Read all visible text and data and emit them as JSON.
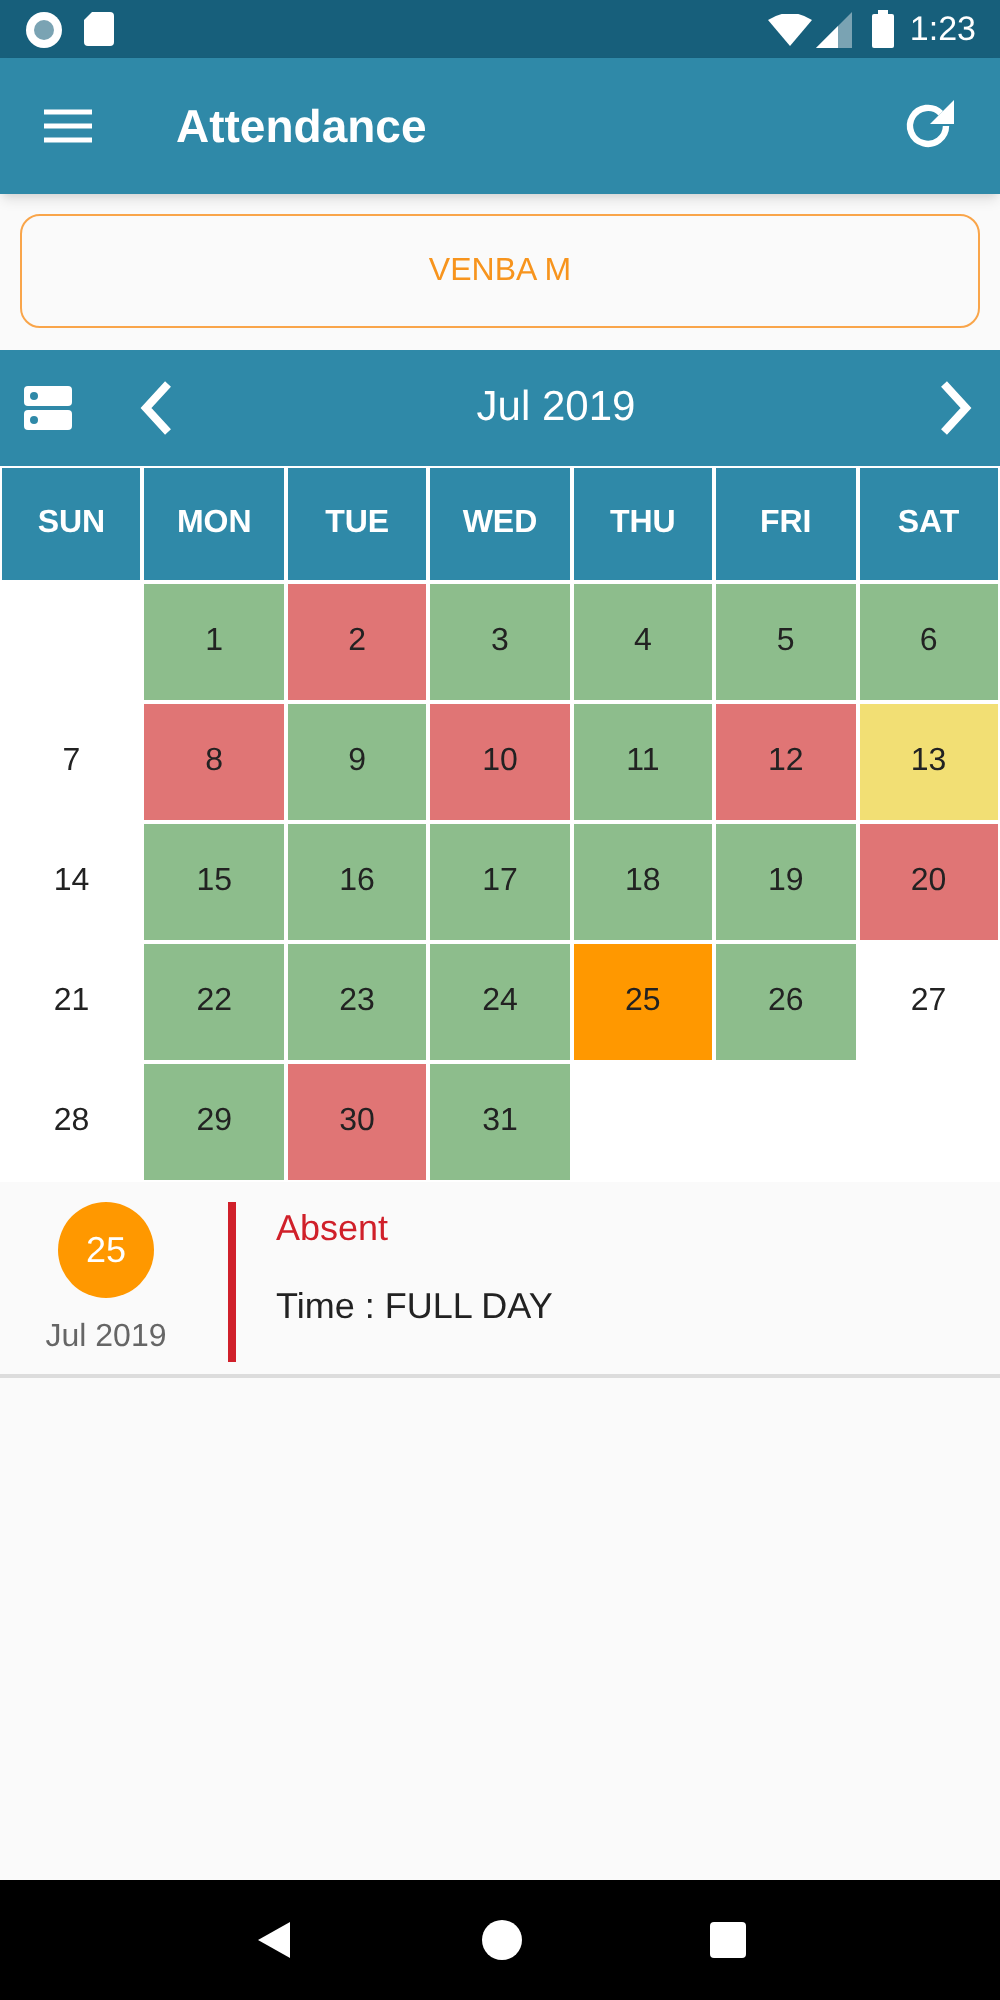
{
  "status_bar": {
    "time": "1:23"
  },
  "app_bar": {
    "title": "Attendance"
  },
  "employee": {
    "name": "VENBA M"
  },
  "calendar": {
    "month": "Jul 2019",
    "weekdays": [
      "SUN",
      "MON",
      "TUE",
      "WED",
      "THU",
      "FRI",
      "SAT"
    ],
    "weeks": [
      [
        {
          "kind": "blank"
        },
        {
          "kind": "day",
          "day": "1",
          "color": "#8dbd8c",
          "selected": false
        },
        {
          "kind": "day",
          "day": "2",
          "color": "#e07575",
          "selected": false
        },
        {
          "kind": "day",
          "day": "3",
          "color": "#8dbd8c",
          "selected": false
        },
        {
          "kind": "day",
          "day": "4",
          "color": "#8dbd8c",
          "selected": false
        },
        {
          "kind": "day",
          "day": "5",
          "color": "#8dbd8c",
          "selected": false
        },
        {
          "kind": "day",
          "day": "6",
          "color": "#8dbd8c",
          "selected": false
        }
      ],
      [
        {
          "kind": "day",
          "day": "7",
          "selected": false
        },
        {
          "kind": "day",
          "day": "8",
          "color": "#e07575",
          "selected": false
        },
        {
          "kind": "day",
          "day": "9",
          "color": "#8dbd8c",
          "selected": false
        },
        {
          "kind": "day",
          "day": "10",
          "color": "#e07575",
          "selected": false
        },
        {
          "kind": "day",
          "day": "11",
          "color": "#8dbd8c",
          "selected": false
        },
        {
          "kind": "day",
          "day": "12",
          "color": "#e07575",
          "selected": false
        },
        {
          "kind": "day",
          "day": "13",
          "color": "#f2df74",
          "selected": false
        }
      ],
      [
        {
          "kind": "day",
          "day": "14",
          "selected": false
        },
        {
          "kind": "day",
          "day": "15",
          "color": "#8dbd8c",
          "selected": false
        },
        {
          "kind": "day",
          "day": "16",
          "color": "#8dbd8c",
          "selected": false
        },
        {
          "kind": "day",
          "day": "17",
          "color": "#8dbd8c",
          "selected": false
        },
        {
          "kind": "day",
          "day": "18",
          "color": "#8dbd8c",
          "selected": false
        },
        {
          "kind": "day",
          "day": "19",
          "color": "#8dbd8c",
          "selected": false
        },
        {
          "kind": "day",
          "day": "20",
          "color": "#e07575",
          "selected": false
        }
      ],
      [
        {
          "kind": "day",
          "day": "21",
          "selected": false
        },
        {
          "kind": "day",
          "day": "22",
          "color": "#8dbd8c",
          "selected": false
        },
        {
          "kind": "day",
          "day": "23",
          "color": "#8dbd8c",
          "selected": false
        },
        {
          "kind": "day",
          "day": "24",
          "color": "#8dbd8c",
          "selected": false
        },
        {
          "kind": "day",
          "day": "25",
          "selected": true
        },
        {
          "kind": "day",
          "day": "26",
          "color": "#8dbd8c",
          "selected": false
        },
        {
          "kind": "day",
          "day": "27",
          "selected": false
        }
      ],
      [
        {
          "kind": "day",
          "day": "28",
          "selected": false
        },
        {
          "kind": "day",
          "day": "29",
          "color": "#8dbd8c",
          "selected": false
        },
        {
          "kind": "day",
          "day": "30",
          "color": "#e07575",
          "selected": false
        },
        {
          "kind": "day",
          "day": "31",
          "color": "#8dbd8c",
          "selected": false
        }
      ]
    ]
  },
  "detail": {
    "day": "25",
    "month": "Jul 2019",
    "status": "Absent",
    "time": "Time : FULL DAY"
  }
}
